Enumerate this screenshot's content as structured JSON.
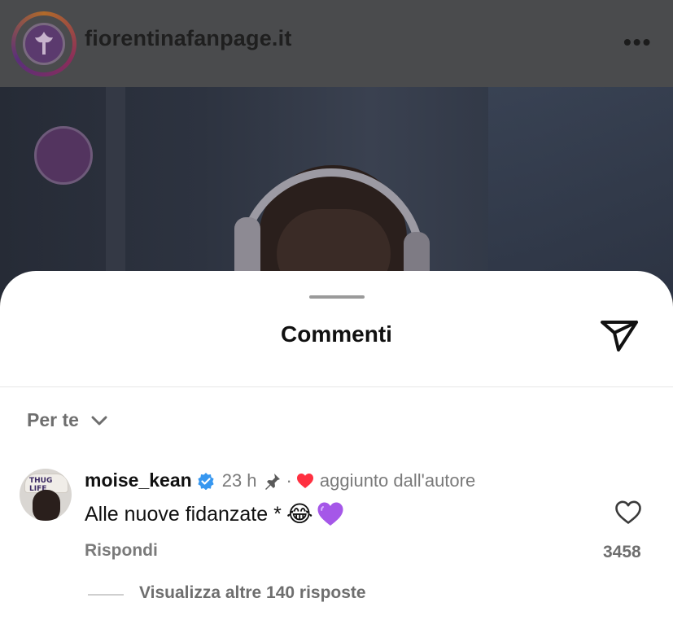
{
  "header": {
    "username": "fiorentinafanpage.it",
    "avatar_icon": "fiorentina-lily-logo",
    "more_icon": "more-dots-icon",
    "more_symbol": "•••"
  },
  "comments_sheet": {
    "title": "Commenti",
    "send_icon": "paper-plane-icon",
    "filter": {
      "label": "Per te",
      "icon": "chevron-down-icon"
    }
  },
  "comment": {
    "username": "moise_kean",
    "verified": true,
    "time": "23 h",
    "separator": "·",
    "added_by_author": "aggiunto dall'autore",
    "avatar_cap_text": "THUG LIFE",
    "text": "Alle nuove fidanzate *",
    "emoji_laugh": "😂",
    "emoji_heart": "purple-heart",
    "reply_label": "Rispondi",
    "like_count": "3458",
    "view_replies": "Visualizza altre 140 risposte"
  },
  "colors": {
    "accent_blue": "#3797f0",
    "heart_red": "#ff3040",
    "purple_heart": "#a557e8"
  }
}
